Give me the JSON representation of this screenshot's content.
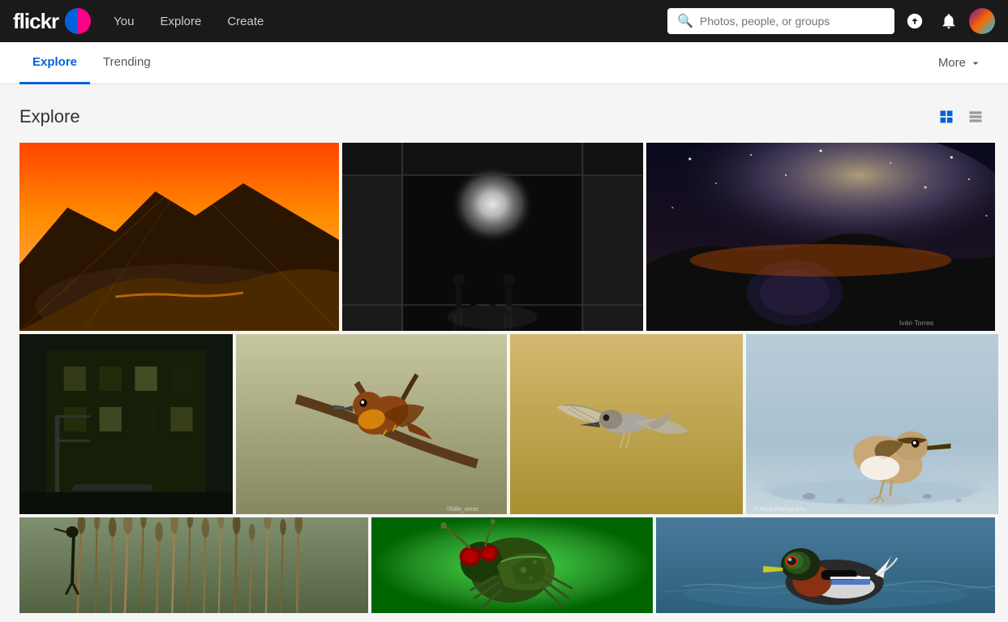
{
  "navbar": {
    "logo_text": "flickr",
    "you_label": "You",
    "explore_label": "Explore",
    "create_label": "Create",
    "search_placeholder": "Photos, people, or groups",
    "upload_tooltip": "Upload",
    "notifications_tooltip": "Notifications",
    "avatar_tooltip": "Profile"
  },
  "subnav": {
    "explore_tab": "Explore",
    "trending_tab": "Trending",
    "more_label": "More"
  },
  "content": {
    "title": "Explore",
    "view_grid_label": "Grid view",
    "view_list_label": "List view"
  },
  "photos": {
    "row1": [
      {
        "id": "photo-mountain-sunset",
        "alt": "Mountain river at sunset",
        "color": "#c8521a"
      },
      {
        "id": "photo-silhouettes-tunnel",
        "alt": "Silhouettes in a tunnel",
        "color": "#1a1a1a"
      },
      {
        "id": "photo-milky-way-lake",
        "alt": "Milky way over lake",
        "color": "#1a1a3e"
      }
    ],
    "row2": [
      {
        "id": "photo-urban-building",
        "alt": "Urban building at night",
        "color": "#1a1a1a"
      },
      {
        "id": "photo-bird-branch",
        "alt": "Bird on branch",
        "color": "#8B6914"
      },
      {
        "id": "photo-bird-flying",
        "alt": "Bird flying",
        "color": "#c8a040"
      },
      {
        "id": "photo-sandpiper",
        "alt": "Sandpiper wading",
        "color": "#a8b8c8"
      }
    ],
    "row3": [
      {
        "id": "photo-reeds-mist",
        "alt": "Reeds in mist",
        "color": "#556b2f"
      },
      {
        "id": "photo-beetle-closeup",
        "alt": "Green beetle close up",
        "color": "#228b22"
      },
      {
        "id": "photo-duck-water",
        "alt": "Duck on water",
        "color": "#4a7a9b"
      }
    ]
  }
}
